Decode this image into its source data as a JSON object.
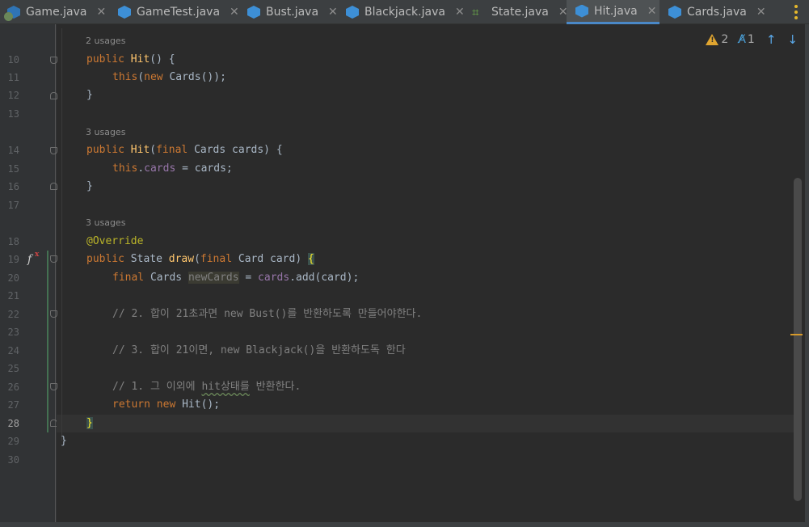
{
  "tabs": [
    {
      "label": "Game.java",
      "icon": "java-class-run-icon",
      "active": false
    },
    {
      "label": "GameTest.java",
      "icon": "java-class-icon",
      "active": false
    },
    {
      "label": "Bust.java",
      "icon": "java-class-icon",
      "active": false
    },
    {
      "label": "Blackjack.java",
      "icon": "java-class-icon",
      "active": false
    },
    {
      "label": "State.java",
      "icon": "java-interface-icon",
      "active": false
    },
    {
      "label": "Hit.java",
      "icon": "java-class-icon",
      "active": true
    },
    {
      "label": "Cards.java",
      "icon": "java-class-icon",
      "active": false
    }
  ],
  "close_glyph": "✕",
  "inspections": {
    "warnings": "2",
    "typos": "1"
  },
  "line_numbers": [
    "10",
    "11",
    "12",
    "13",
    "14",
    "15",
    "16",
    "17",
    "18",
    "19",
    "20",
    "21",
    "22",
    "23",
    "24",
    "25",
    "26",
    "27",
    "28",
    "29",
    "30"
  ],
  "current_line": "28",
  "usages": {
    "first": "2 usages",
    "second": "3 usages",
    "third": "3 usages"
  },
  "code": {
    "l10": {
      "kw": "public",
      "name": "Hit",
      "rest": "() {"
    },
    "l11": {
      "kw1": "this",
      "p1": "(",
      "kw2": "new",
      "rest": " Cards());"
    },
    "l12": "}",
    "l14": {
      "kw": "public",
      "name": "Hit",
      "p1": "(",
      "kw2": "final",
      "rest": " Cards cards) {"
    },
    "l15": {
      "kw": "this",
      "dot": ".",
      "field": "cards",
      "rest": " = cards;"
    },
    "l16": "}",
    "l18": "@Override",
    "l19": {
      "kw": "public",
      "type": " State ",
      "name": "draw",
      "p1": "(",
      "kw2": "final",
      "rest": " Card card) ",
      "brace": "{"
    },
    "l20": {
      "kw": "final",
      "type": " Cards ",
      "var": "newCards",
      "mid": " = ",
      "field": "cards",
      "rest": ".add(card);"
    },
    "l22": "// 2. 합이 21초과면 new Bust()를 반환하도록 만들어야한다.",
    "l24": "// 3. 합이 21이면, new Blackjack()을 반환하도독 한다",
    "l26": {
      "pre": "// 1. 그 이외에 ",
      "wavy": "hit상태를",
      "post": " 반환한다."
    },
    "l27": {
      "kw1": "return",
      "kw2": " new",
      "rest": " Hit();"
    },
    "l28": "}",
    "l29": "}"
  }
}
